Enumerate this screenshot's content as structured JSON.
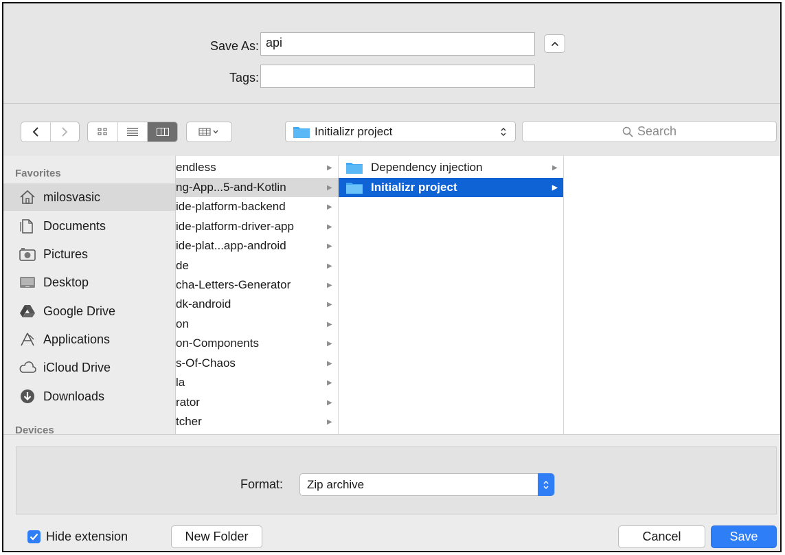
{
  "name_area": {
    "save_as_label": "Save As:",
    "save_as_value": "api",
    "tags_label": "Tags:",
    "tags_value": ""
  },
  "toolbar": {
    "current_folder": "Initializr project",
    "search_placeholder": "Search"
  },
  "sidebar": {
    "favorites_header": "Favorites",
    "devices_header": "Devices",
    "items": [
      {
        "label": "milosvasic",
        "icon": "home-icon",
        "selected": true
      },
      {
        "label": "Documents",
        "icon": "documents-icon"
      },
      {
        "label": "Pictures",
        "icon": "camera-icon"
      },
      {
        "label": "Desktop",
        "icon": "desktop-icon"
      },
      {
        "label": "Google Drive",
        "icon": "google-drive-icon"
      },
      {
        "label": "Applications",
        "icon": "applications-icon"
      },
      {
        "label": "iCloud Drive",
        "icon": "cloud-icon"
      },
      {
        "label": "Downloads",
        "icon": "downloads-icon"
      }
    ]
  },
  "column1": {
    "items": [
      "endless",
      "ng-App...5-and-Kotlin",
      "ide-platform-backend",
      "ide-platform-driver-app",
      "ide-plat...app-android",
      "de",
      "cha-Letters-Generator",
      "dk-android",
      "on",
      "on-Components",
      "s-Of-Chaos",
      "la",
      "rator",
      "tcher"
    ]
  },
  "column2": {
    "items": [
      {
        "label": "Dependency injection",
        "selected": false
      },
      {
        "label": "Initializr project",
        "selected": true
      }
    ]
  },
  "bottom": {
    "format_label": "Format:",
    "format_value": "Zip archive",
    "hide_extension_label": "Hide extension",
    "hide_extension_checked": true,
    "new_folder_label": "New Folder",
    "cancel_label": "Cancel",
    "save_label": "Save"
  },
  "colors": {
    "selection": "#0f63d5",
    "accent": "#2e7ef7",
    "folder": "#3fa9f5"
  }
}
